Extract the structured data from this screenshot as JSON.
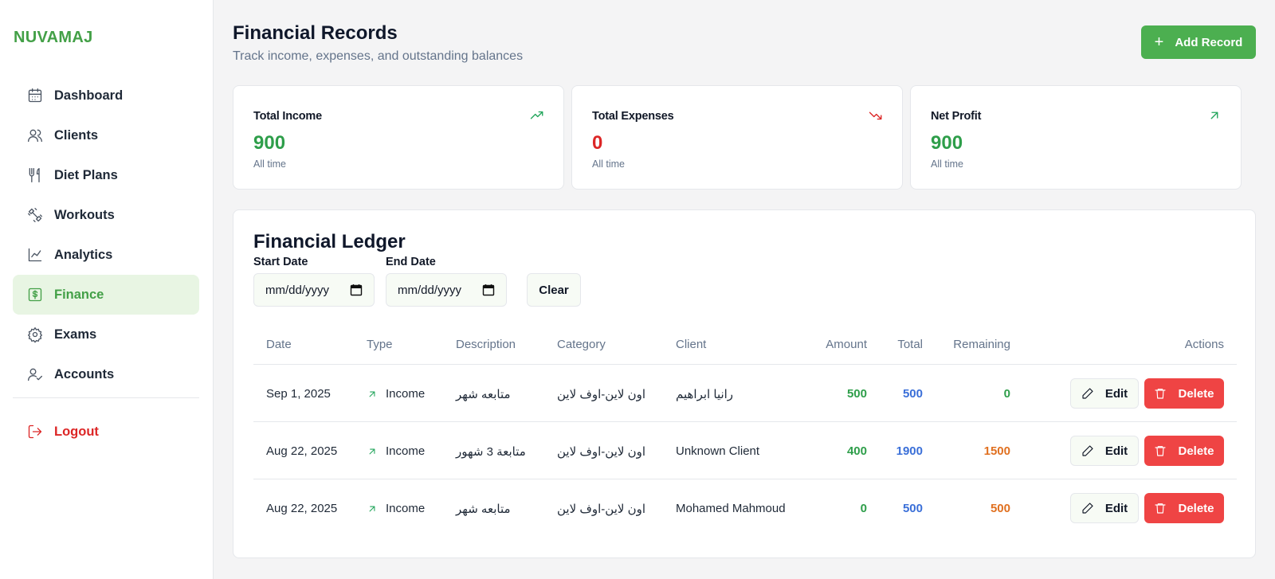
{
  "brand": "NUVAMAJ",
  "sidebar": {
    "items": [
      {
        "label": "Dashboard",
        "icon": "calendar-icon"
      },
      {
        "label": "Clients",
        "icon": "users-icon"
      },
      {
        "label": "Diet Plans",
        "icon": "utensils-icon"
      },
      {
        "label": "Workouts",
        "icon": "dumbbell-icon"
      },
      {
        "label": "Analytics",
        "icon": "chart-line-icon"
      },
      {
        "label": "Finance",
        "icon": "dollar-square-icon",
        "active": true
      },
      {
        "label": "Exams",
        "icon": "gear-icon"
      },
      {
        "label": "Accounts",
        "icon": "user-check-icon"
      }
    ],
    "logout": "Logout"
  },
  "header": {
    "title": "Financial Records",
    "subtitle": "Track income, expenses, and outstanding balances",
    "add_label": "Add Record"
  },
  "stats": [
    {
      "label": "Total Income",
      "value": "900",
      "hint": "All time",
      "color": "#2e9e4a",
      "icon": "trending-up-icon"
    },
    {
      "label": "Total Expenses",
      "value": "0",
      "hint": "All time",
      "color": "#dc2626",
      "icon": "trending-down-icon"
    },
    {
      "label": "Net Profit",
      "value": "900",
      "hint": "All time",
      "color": "#2e9e4a",
      "icon": "arrow-up-right-icon"
    }
  ],
  "ledger": {
    "title": "Financial Ledger",
    "start_label": "Start Date",
    "end_label": "End Date",
    "start_value": "mm/dd/yyyy",
    "end_value": "mm/dd/yyyy",
    "clear_label": "Clear",
    "columns": [
      "Date",
      "Type",
      "Description",
      "Category",
      "Client",
      "Amount",
      "Total",
      "Remaining",
      "Actions"
    ],
    "rows": [
      {
        "date": "Sep 1, 2025",
        "type": "Income",
        "description": "متابعه شهر",
        "category": "اون لاين-اوف لاين",
        "client": "رانيا ابراهيم",
        "amount": "500",
        "total": "500",
        "remaining": "0"
      },
      {
        "date": "Aug 22, 2025",
        "type": "Income",
        "description": "متابعة 3 شهور",
        "category": "اون لاين-اوف لاين",
        "client": "Unknown Client",
        "amount": "400",
        "total": "1900",
        "remaining": "1500"
      },
      {
        "date": "Aug 22, 2025",
        "type": "Income",
        "description": "متابعه شهر",
        "category": "اون لاين-اوف لاين",
        "client": "Mohamed Mahmoud",
        "amount": "0",
        "total": "500",
        "remaining": "500"
      }
    ],
    "edit_label": "Edit",
    "delete_label": "Delete"
  },
  "colors": {
    "accent": "#4caf50",
    "income": "#2e9e4a",
    "total": "#3a6fd8",
    "remaining_due": "#e07020",
    "danger": "#ef4444"
  }
}
